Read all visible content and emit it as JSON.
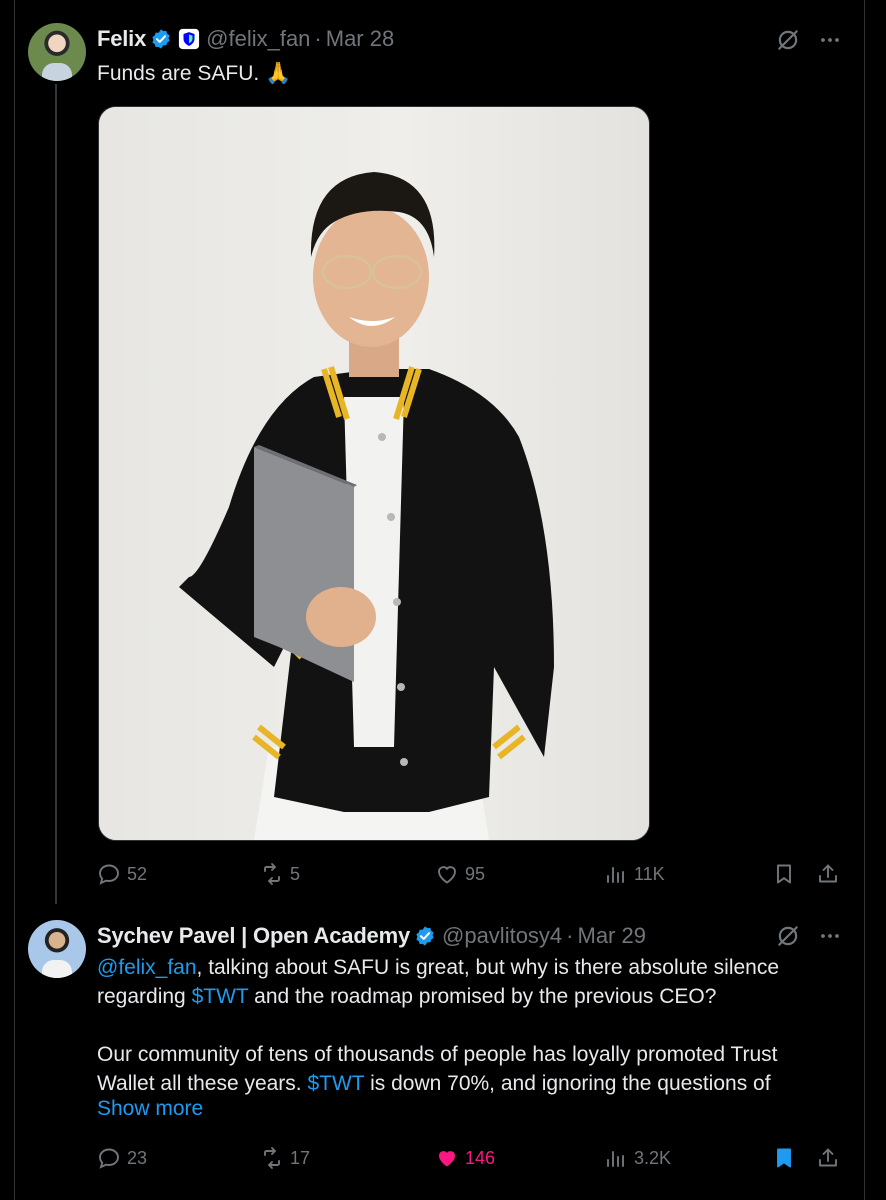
{
  "tweet1": {
    "author_name": "Felix",
    "handle": "@felix_fan",
    "date": "Mar 28",
    "text": "Funds are SAFU. 🙏",
    "metrics": {
      "replies": "52",
      "reposts": "5",
      "likes": "95",
      "views": "11K"
    }
  },
  "tweet2": {
    "author_name": "Sychev Pavel | Open Academy",
    "handle": "@pavlitosy4",
    "date": "Mar 29",
    "line1_mention": "@felix_fan",
    "line1_rest": ", talking about SAFU is great, but why is there absolute silence",
    "line2_pre": "regarding ",
    "line2_ticker": "$TWT",
    "line2_post": " and the roadmap promised by the previous CEO?",
    "line3": "Our community of tens of thousands of people has loyally promoted Trust",
    "line4_pre": "Wallet all these years. ",
    "line4_ticker": "$TWT",
    "line4_post": " is down 70%, and ignoring the questions of",
    "show_more": "Show more",
    "metrics": {
      "replies": "23",
      "reposts": "17",
      "likes": "146",
      "views": "3.2K"
    }
  },
  "colors": {
    "background": "#000000",
    "text": "#e7e9ea",
    "muted": "#71767b",
    "link": "#1d9bf0",
    "like_active": "#f91880",
    "verified": "#1d9bf0"
  },
  "icons": [
    "verified-badge-icon",
    "affiliate-badge-icon",
    "grok-icon",
    "more-icon",
    "reply-icon",
    "repost-icon",
    "like-icon",
    "views-icon",
    "bookmark-icon",
    "share-icon"
  ]
}
